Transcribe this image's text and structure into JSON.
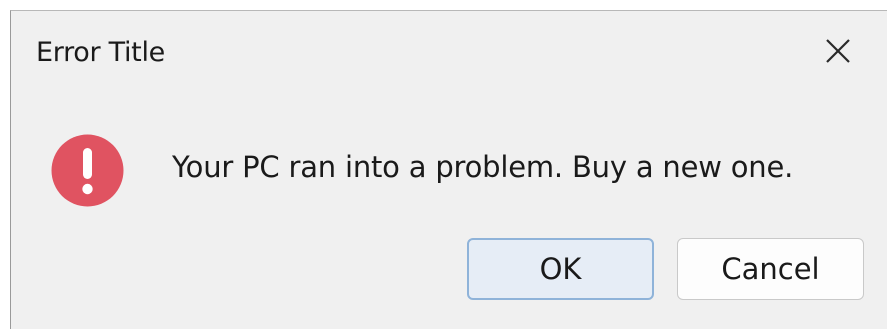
{
  "dialog": {
    "title": "Error Title",
    "message": "Your PC ran into a problem. Buy a new one.",
    "icon": "error-icon",
    "close_icon": "close-icon",
    "buttons": {
      "ok_label": "OK",
      "cancel_label": "Cancel"
    },
    "colors": {
      "error_icon": "#e05361",
      "default_button_border": "#8fb3d9",
      "default_button_fill": "#e6edf6",
      "dialog_background": "#f0f0f0"
    }
  }
}
